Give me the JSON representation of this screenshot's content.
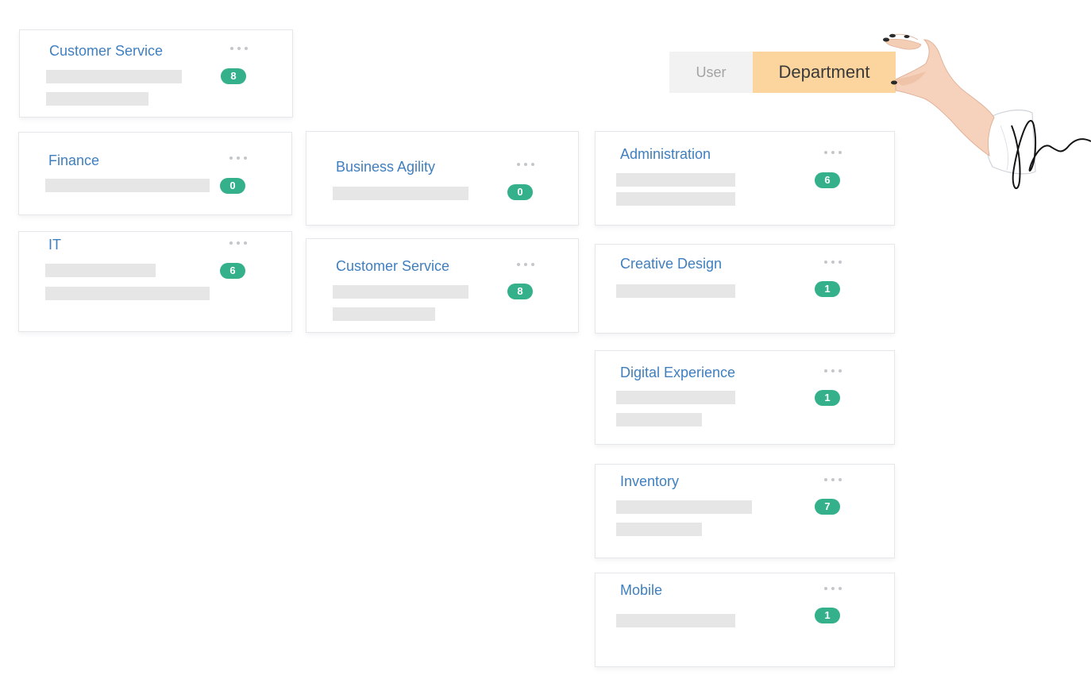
{
  "toggle": {
    "user_label": "User",
    "department_label": "Department",
    "active": "Department"
  },
  "colors": {
    "title": "#3f7fbf",
    "badge": "#34b08a",
    "active_toggle": "#fcd49d",
    "inactive_toggle": "#f2f2f2"
  },
  "columns": [
    {
      "cards": [
        {
          "name": "Customer Service",
          "count": "8"
        },
        {
          "name": "Finance",
          "count": "0"
        },
        {
          "name": "IT",
          "count": "6"
        }
      ]
    },
    {
      "cards": [
        {
          "name": "Business Agility",
          "count": "0"
        },
        {
          "name": "Customer Service",
          "count": "8"
        }
      ]
    },
    {
      "cards": [
        {
          "name": "Administration",
          "count": "6"
        },
        {
          "name": "Creative Design",
          "count": "1"
        },
        {
          "name": "Digital Experience",
          "count": "1"
        },
        {
          "name": "Inventory",
          "count": "7"
        },
        {
          "name": "Mobile",
          "count": "1"
        }
      ]
    }
  ]
}
